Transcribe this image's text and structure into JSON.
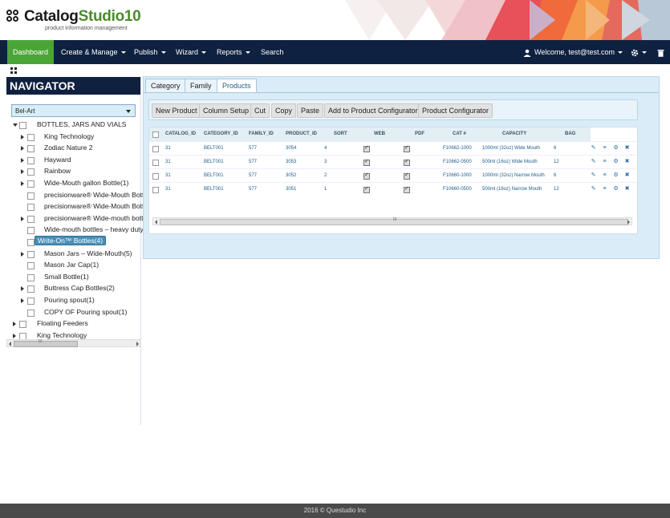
{
  "brand": {
    "name_part1": "Catalog",
    "name_part2": "Studio10",
    "tagline": "product information management"
  },
  "nav": {
    "items": [
      {
        "label": "Dashboard",
        "dropdown": false,
        "active": true
      },
      {
        "label": "Create & Manage",
        "dropdown": true
      },
      {
        "label": "Publish",
        "dropdown": true
      },
      {
        "label": "Wizard",
        "dropdown": true
      },
      {
        "label": "Reports",
        "dropdown": true
      },
      {
        "label": "Search",
        "dropdown": false
      }
    ],
    "welcome": "Welcome, test@test.com"
  },
  "navigator": {
    "title": "NAVIGATOR",
    "catalog_selected": "Bel-Art",
    "tree": [
      {
        "label": "BOTTLES, JARS AND VIALS",
        "level": 0,
        "arrow": "open"
      },
      {
        "label": "King Technology",
        "level": 1,
        "arrow": "closed"
      },
      {
        "label": "Zodiac Nature 2",
        "level": 1,
        "arrow": "closed"
      },
      {
        "label": "Hayward",
        "level": 1,
        "arrow": "closed"
      },
      {
        "label": "Rainbow",
        "level": 1,
        "arrow": "closed"
      },
      {
        "label": "Wide-Mouth gallon Bottle(1)",
        "level": 1,
        "arrow": "closed"
      },
      {
        "label": "precisionware® Wide-Mouth Bott",
        "level": 1,
        "arrow": "none"
      },
      {
        "label": "precisionware® Wide-Mouth Bott",
        "level": 1,
        "arrow": "none"
      },
      {
        "label": "precisionware® Wide-mouth bott",
        "level": 1,
        "arrow": "closed"
      },
      {
        "label": "Wide-mouth bottles – heavy duty",
        "level": 1,
        "arrow": "none"
      },
      {
        "label": "Write-On™ Bottles(4)",
        "level": 1,
        "arrow": "none",
        "selected": true
      },
      {
        "label": "Mason Jars – Wide-Mouth(5)",
        "level": 1,
        "arrow": "closed"
      },
      {
        "label": "Mason Jar Cap(1)",
        "level": 1,
        "arrow": "none"
      },
      {
        "label": "Small Bottle(1)",
        "level": 1,
        "arrow": "none"
      },
      {
        "label": "Buttress Cap Bottles(2)",
        "level": 1,
        "arrow": "closed"
      },
      {
        "label": "Pouring spout(1)",
        "level": 1,
        "arrow": "closed"
      },
      {
        "label": "COPY OF Pouring spout(1)",
        "level": 1,
        "arrow": "none"
      },
      {
        "label": "Floating Feeders",
        "level": 0,
        "arrow": "closed"
      },
      {
        "label": "King Technology",
        "level": 0,
        "arrow": "closed"
      }
    ],
    "scroll_glyph": "III"
  },
  "tabs": [
    "Category",
    "Family",
    "Products"
  ],
  "active_tab": 2,
  "toolbar": [
    "New Product",
    "Column Setup",
    "Cut",
    "Copy",
    "Paste",
    "Add to Product Configurator",
    "Product Configurator"
  ],
  "grid": {
    "columns": [
      "CATALOG_ID",
      "CATEGORY_ID",
      "FAMILY_ID",
      "PRODUCT_ID",
      "SORT",
      "WEB",
      "PDF",
      "CAT #",
      "CAPACITY",
      "BAG"
    ],
    "rows": [
      {
        "catalog_id": "31",
        "category_id": "BELT001",
        "family_id": "577",
        "product_id": "3054",
        "sort": "4",
        "web": true,
        "pdf": true,
        "cat": "F10662-1000",
        "capacity": "1000ml (32oz) Wide Mouth",
        "bag": "6"
      },
      {
        "catalog_id": "31",
        "category_id": "BELT001",
        "family_id": "577",
        "product_id": "3053",
        "sort": "3",
        "web": true,
        "pdf": true,
        "cat": "F10662-0500",
        "capacity": "500ml (16oz) Wide Mouth",
        "bag": "12"
      },
      {
        "catalog_id": "31",
        "category_id": "BELT001",
        "family_id": "577",
        "product_id": "3052",
        "sort": "2",
        "web": true,
        "pdf": true,
        "cat": "F10660-1000",
        "capacity": "1000ml (32oz) Narrow Mouth",
        "bag": "6"
      },
      {
        "catalog_id": "31",
        "category_id": "BELT001",
        "family_id": "577",
        "product_id": "3051",
        "sort": "1",
        "web": true,
        "pdf": true,
        "cat": "F10660-0500",
        "capacity": "500ml (16oz) Narrow Mouth",
        "bag": "12"
      }
    ],
    "row_icons": [
      "edit-icon",
      "list-icon",
      "settings-icon",
      "delete-icon"
    ],
    "scroll_glyph": "III"
  },
  "footer": "2016 © Questudio Inc",
  "colors": {
    "nav_bg": "#0f2140",
    "active_green": "#4aa536",
    "panel_bg": "#d9ecf7",
    "link_blue": "#1f5d8c"
  }
}
